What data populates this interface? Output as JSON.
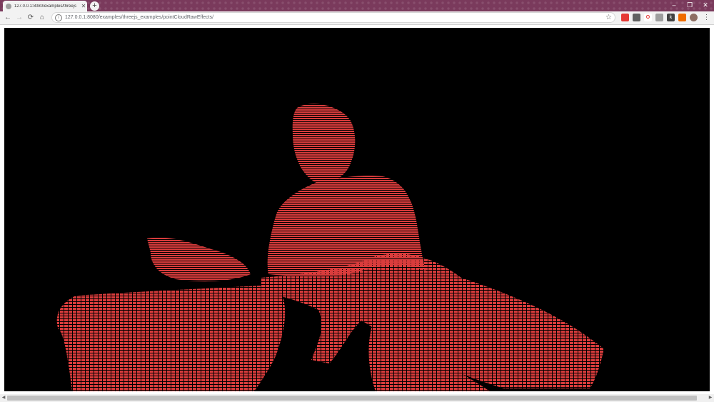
{
  "browser": {
    "tab": {
      "title": "127.0.0.1:8080/examples/threejs",
      "close_icon": "close-icon",
      "favicon": "globe-icon"
    },
    "new_tab_icon": "plus-icon",
    "window_controls": [
      "minimize-icon",
      "restore-icon",
      "close-icon"
    ],
    "nav": {
      "back": "←",
      "forward": "→",
      "reload": "⟳",
      "home": "⌂"
    },
    "address": {
      "url": "127.0.0.1:8080/examples/threejs_examples/pointCloudRawEffects/",
      "info_icon": "info-icon",
      "bookmark_icon": "star-icon"
    },
    "extensions": [
      {
        "name": "extension-red-icon",
        "color": "#e53935"
      },
      {
        "name": "extension-dark-icon",
        "color": "#616161"
      },
      {
        "name": "opera-icon",
        "color": "#e53935"
      },
      {
        "name": "extension-grey-icon",
        "color": "#9e9e9e"
      },
      {
        "name": "extension-k-icon",
        "color": "#424242"
      },
      {
        "name": "extension-orange-icon",
        "color": "#ef6c00"
      },
      {
        "name": "extension-puzzle-icon",
        "color": "#455a64"
      },
      {
        "name": "profile-avatar-icon",
        "color": "#8d6e63"
      }
    ],
    "menu_icon": "kebab-menu-icon"
  },
  "colors": {
    "tabbar": "#7a3a5c",
    "canvas": "#000000",
    "gradient": [
      "#d93c3c",
      "#e8a030",
      "#d6c830",
      "#3cc84a",
      "#30c8b8",
      "#3a7ad8",
      "#6a4ad8",
      "#a040d0"
    ]
  }
}
